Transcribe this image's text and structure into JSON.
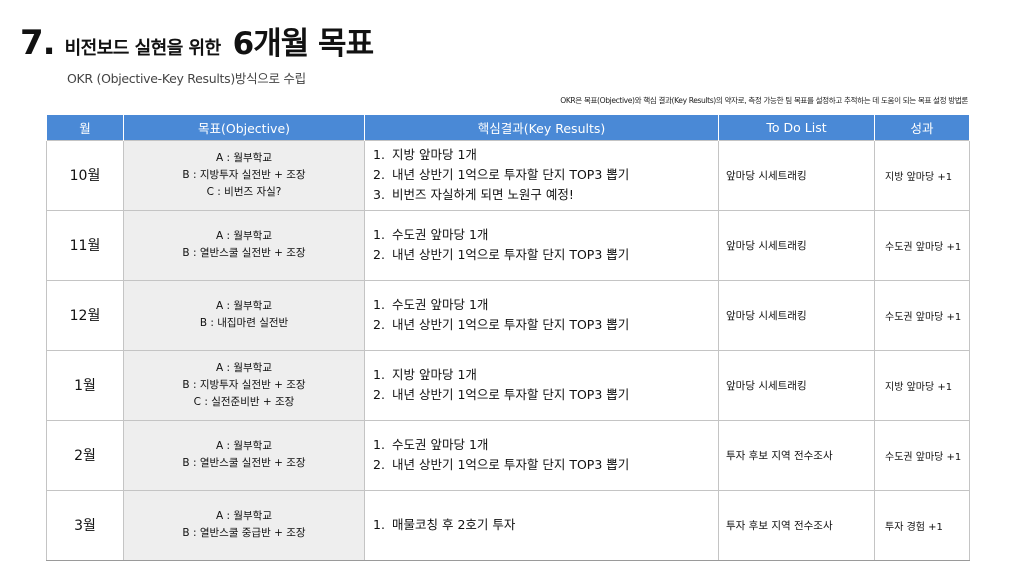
{
  "header": {
    "number": "7.",
    "title_small": "비전보드 실현을 위한",
    "title_big": "6개월 목표",
    "subtitle": "OKR (Objective-Key Results)방식으로 수립",
    "note": "OKR은 목표(Objective)와 핵심 결과(Key Results)의 약자로, 측정 가능한 팀 목표를 설정하고 추적하는 데 도움이 되는 목표 설정 방법론"
  },
  "table": {
    "columns": [
      "월",
      "목표(Objective)",
      "핵심결과(Key Results)",
      "To Do List",
      "성과"
    ],
    "rows": [
      {
        "month": "10월",
        "objectives": [
          "A : 월부학교",
          "B : 지방투자 실전반 + 조장",
          "C : 비번즈 자실?"
        ],
        "key_results": [
          "지방 앞마당 1개",
          "내년 상반기 1억으로 투자할 단지 TOP3 뽑기",
          "비번즈 자실하게 되면 노원구 예정!"
        ],
        "todo": "앞마당 시세트래킹",
        "result": "지방 앞마당 +1"
      },
      {
        "month": "11월",
        "objectives": [
          "A : 월부학교",
          "B : 열반스쿨 실전반 + 조장"
        ],
        "key_results": [
          "수도권 앞마당 1개",
          "내년 상반기 1억으로 투자할 단지 TOP3 뽑기"
        ],
        "todo": "앞마당 시세트래킹",
        "result": "수도권 앞마당 +1"
      },
      {
        "month": "12월",
        "objectives": [
          "A : 월부학교",
          "B : 내집마련 실전반"
        ],
        "key_results": [
          "수도권 앞마당 1개",
          "내년 상반기 1억으로 투자할 단지 TOP3 뽑기"
        ],
        "todo": "앞마당 시세트래킹",
        "result": "수도권 앞마당 +1"
      },
      {
        "month": "1월",
        "objectives": [
          "A : 월부학교",
          "B : 지방투자 실전반 + 조장",
          "C : 실전준비반 + 조장"
        ],
        "key_results": [
          "지방 앞마당 1개",
          "내년 상반기 1억으로 투자할 단지 TOP3 뽑기"
        ],
        "todo": "앞마당 시세트래킹",
        "result": "지방 앞마당 +1"
      },
      {
        "month": "2월",
        "objectives": [
          "A : 월부학교",
          "B : 열반스쿨 실전반 + 조장"
        ],
        "key_results": [
          "수도권 앞마당 1개",
          "내년 상반기 1억으로 투자할 단지 TOP3 뽑기"
        ],
        "todo": "투자 후보 지역 전수조사",
        "result": "수도권 앞마당 +1"
      },
      {
        "month": "3월",
        "objectives": [
          "A : 월부학교",
          "B : 열반스쿨 중급반 + 조장"
        ],
        "key_results": [
          "매물코칭 후 2호기 투자"
        ],
        "todo": "투자 후보 지역 전수조사",
        "result": "투자 경험 +1"
      }
    ]
  },
  "colors": {
    "header_bg": "#4a89d6",
    "objective_bg": "#eeeeee",
    "grid": "#c4c4c4"
  }
}
